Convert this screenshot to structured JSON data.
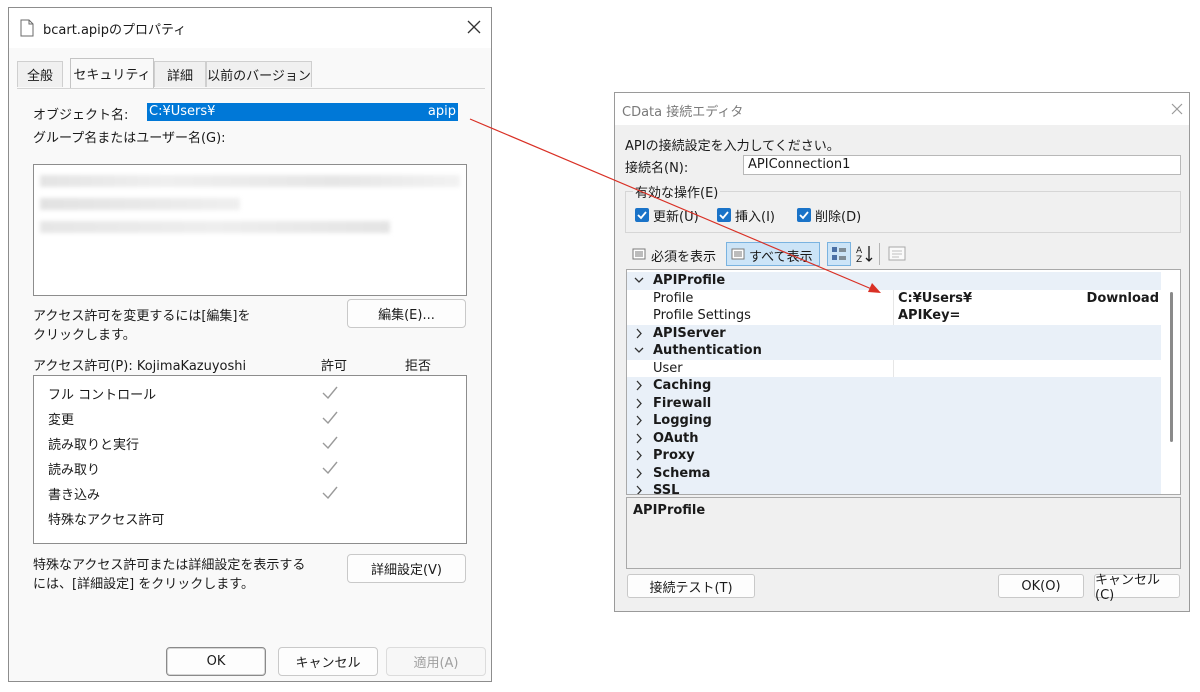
{
  "properties_window": {
    "title": "bcart.apipのプロパティ",
    "tabs": [
      "全般",
      "セキュリティ",
      "詳細",
      "以前のバージョン"
    ],
    "object_name_label": "オブジェクト名:",
    "object_name_value": "C:¥Users¥",
    "object_name_tail": "apip",
    "group_label": "グループ名またはユーザー名(G):",
    "change_note_line1": "アクセス許可を変更するには[編集]を",
    "change_note_line2": "クリックします。",
    "edit_button": "編集(E)...",
    "permissions_label": "アクセス許可(P): KojimaKazuyoshi",
    "allow_header": "許可",
    "deny_header": "拒否",
    "permissions": [
      {
        "name": "フル コントロール",
        "allow": true
      },
      {
        "name": "変更",
        "allow": true
      },
      {
        "name": "読み取りと実行",
        "allow": true
      },
      {
        "name": "読み取り",
        "allow": true
      },
      {
        "name": "書き込み",
        "allow": true
      },
      {
        "name": "特殊なアクセス許可",
        "allow": false
      }
    ],
    "advanced_note_line1": "特殊なアクセス許可または詳細設定を表示する",
    "advanced_note_line2": "には、[詳細設定] をクリックします。",
    "advanced_button": "詳細設定(V)",
    "ok_button": "OK",
    "cancel_button": "キャンセル",
    "apply_button": "適用(A)"
  },
  "connection_editor": {
    "title": "CData 接続エディタ",
    "prompt": "APIの接続設定を入力してください。",
    "connection_name_label": "接続名(N):",
    "connection_name_value": "APIConnection1",
    "operations_group": "有効な操作(E)",
    "operations": [
      "更新(U)",
      "挿入(I)",
      "削除(D)"
    ],
    "toolbar": {
      "required_button": "必須を表示",
      "all_button": "すべて表示"
    },
    "property_grid": [
      {
        "name": "APIProfile",
        "category": true,
        "expanded": true,
        "value": ""
      },
      {
        "name": "Profile",
        "category": false,
        "value": "C:¥Users¥",
        "value_tail": "Download"
      },
      {
        "name": "Profile Settings",
        "category": false,
        "value": "APIKey="
      },
      {
        "name": "APIServer",
        "category": true,
        "expanded": false,
        "value": ""
      },
      {
        "name": "Authentication",
        "category": true,
        "expanded": true,
        "value": ""
      },
      {
        "name": "User",
        "category": false,
        "value": ""
      },
      {
        "name": "Caching",
        "category": true,
        "expanded": false,
        "value": ""
      },
      {
        "name": "Firewall",
        "category": true,
        "expanded": false,
        "value": ""
      },
      {
        "name": "Logging",
        "category": true,
        "expanded": false,
        "value": ""
      },
      {
        "name": "OAuth",
        "category": true,
        "expanded": false,
        "value": ""
      },
      {
        "name": "Proxy",
        "category": true,
        "expanded": false,
        "value": ""
      },
      {
        "name": "Schema",
        "category": true,
        "expanded": false,
        "value": ""
      },
      {
        "name": "SSL",
        "category": true,
        "expanded": false,
        "value": ""
      }
    ],
    "description_title": "APIProfile",
    "test_button": "接続テスト(T)",
    "ok_button": "OK(O)",
    "cancel_button": "キャンセル(C)"
  },
  "colors": {
    "accent": "#1a73c8",
    "selection": "#0078d7",
    "arrow": "#d93025",
    "grid_header": "#e9f0f8",
    "grid_bg": "#ffffff"
  }
}
